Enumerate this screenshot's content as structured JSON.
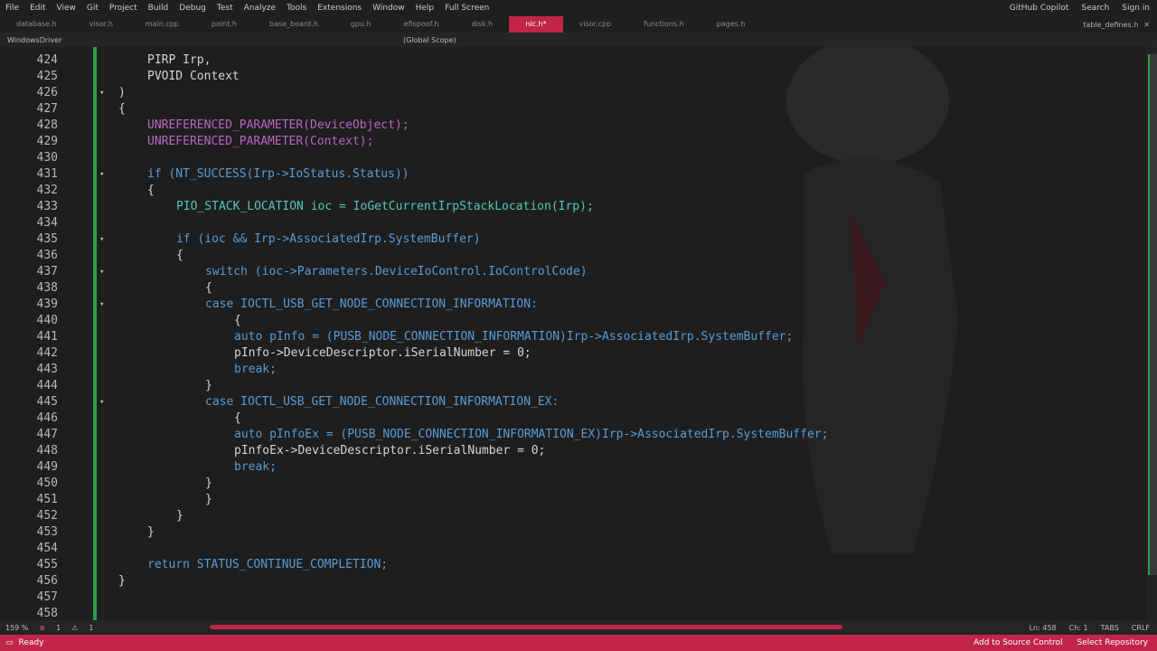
{
  "menu": {
    "items": [
      "File",
      "Edit",
      "View",
      "Git",
      "Project",
      "Build",
      "Debug",
      "Test",
      "Analyze",
      "Tools",
      "Extensions",
      "Window",
      "Help",
      "Full Screen"
    ],
    "copilot": "GitHub Copilot",
    "search": "Search",
    "signin": "Sign in"
  },
  "tabs": [
    "database.h",
    "visor.h",
    "main.cpp",
    "point.h",
    "base_board.h",
    "gpu.h",
    "efispoof.h",
    "disk.h",
    "nic.h*",
    "visor.cpp",
    "functions.h",
    "pages.h"
  ],
  "tab_right": "table_defines.h",
  "nav": {
    "project": "WindowsDriver",
    "scope": "(Global Scope)"
  },
  "code_lines": [
    {
      "n": "424",
      "t": "PIRP Irp,",
      "c": "pl",
      "i": 2
    },
    {
      "n": "425",
      "t": "PVOID Context",
      "c": "pl",
      "i": 2
    },
    {
      "n": "426",
      "t": ")",
      "c": "pl",
      "i": 0,
      "f": true
    },
    {
      "n": "427",
      "t": "{",
      "c": "pl",
      "i": 0
    },
    {
      "n": "428",
      "t": "UNREFERENCED_PARAMETER(DeviceObject);",
      "c": "mac",
      "i": 2
    },
    {
      "n": "429",
      "t": "UNREFERENCED_PARAMETER(Context);",
      "c": "mac",
      "i": 2
    },
    {
      "n": "430",
      "t": "",
      "c": "pl",
      "i": 0
    },
    {
      "n": "431",
      "t": "if (NT_SUCCESS(Irp->IoStatus.Status))",
      "c": "kw",
      "i": 2,
      "f": true
    },
    {
      "n": "432",
      "t": "{",
      "c": "pl",
      "i": 2
    },
    {
      "n": "433",
      "t": "PIO_STACK_LOCATION ioc = IoGetCurrentIrpStackLocation(Irp);",
      "c": "ty",
      "i": 4
    },
    {
      "n": "434",
      "t": "",
      "c": "pl",
      "i": 0
    },
    {
      "n": "435",
      "t": "if (ioc && Irp->AssociatedIrp.SystemBuffer)",
      "c": "kw",
      "i": 4,
      "f": true
    },
    {
      "n": "436",
      "t": "{",
      "c": "pl",
      "i": 4
    },
    {
      "n": "437",
      "t": "switch (ioc->Parameters.DeviceIoControl.IoControlCode)",
      "c": "kw",
      "i": 6,
      "f": true
    },
    {
      "n": "438",
      "t": "{",
      "c": "pl",
      "i": 6
    },
    {
      "n": "439",
      "t": "case IOCTL_USB_GET_NODE_CONNECTION_INFORMATION:",
      "c": "kw",
      "i": 6,
      "f": true
    },
    {
      "n": "440",
      "t": "{",
      "c": "pl",
      "i": 8
    },
    {
      "n": "441",
      "t": "auto pInfo = (PUSB_NODE_CONNECTION_INFORMATION)Irp->AssociatedIrp.SystemBuffer;",
      "c": "kw",
      "i": 8
    },
    {
      "n": "442",
      "t": "pInfo->DeviceDescriptor.iSerialNumber = 0;",
      "c": "pl",
      "i": 8
    },
    {
      "n": "443",
      "t": "break;",
      "c": "kw",
      "i": 8
    },
    {
      "n": "444",
      "t": "}",
      "c": "pl",
      "i": 6
    },
    {
      "n": "445",
      "t": "case IOCTL_USB_GET_NODE_CONNECTION_INFORMATION_EX:",
      "c": "kw",
      "i": 6,
      "f": true
    },
    {
      "n": "446",
      "t": "{",
      "c": "pl",
      "i": 8
    },
    {
      "n": "447",
      "t": "auto pInfoEx = (PUSB_NODE_CONNECTION_INFORMATION_EX)Irp->AssociatedIrp.SystemBuffer;",
      "c": "kw",
      "i": 8
    },
    {
      "n": "448",
      "t": "pInfoEx->DeviceDescriptor.iSerialNumber = 0;",
      "c": "pl",
      "i": 8
    },
    {
      "n": "449",
      "t": "break;",
      "c": "kw",
      "i": 8
    },
    {
      "n": "450",
      "t": "}",
      "c": "pl",
      "i": 6
    },
    {
      "n": "451",
      "t": "}",
      "c": "pl",
      "i": 6
    },
    {
      "n": "452",
      "t": "}",
      "c": "pl",
      "i": 4
    },
    {
      "n": "453",
      "t": "}",
      "c": "pl",
      "i": 2
    },
    {
      "n": "454",
      "t": "",
      "c": "pl",
      "i": 0
    },
    {
      "n": "455",
      "t": "return STATUS_CONTINUE_COMPLETION;",
      "c": "kw",
      "i": 2
    },
    {
      "n": "456",
      "t": "}",
      "c": "pl",
      "i": 0
    },
    {
      "n": "457",
      "t": "",
      "c": "pl",
      "i": 0
    },
    {
      "n": "458",
      "t": "",
      "c": "pl",
      "i": 0
    }
  ],
  "bottom": {
    "zoom": "159 %",
    "errors": "1",
    "warnings": "1",
    "ln": "Ln: 458",
    "ch": "Ch: 1",
    "tabs": "TABS",
    "eol": "CRLF"
  },
  "status": {
    "ready": "Ready",
    "source": "Add to Source Control",
    "repo": "Select Repository"
  },
  "colors": {
    "accent": "#c2254a",
    "change": "#2e9c46"
  }
}
